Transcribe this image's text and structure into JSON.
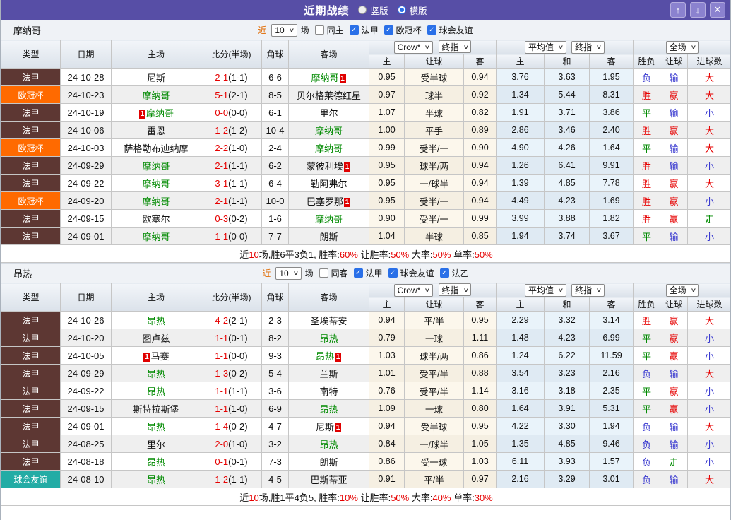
{
  "title_bar": {
    "title": "近期战绩",
    "vertical_label": "竖版",
    "horizontal_label": "横版"
  },
  "glyphs": {
    "up": "↑",
    "down": "↓",
    "close": "✕",
    "check": "✓",
    "chevron_down": "∨"
  },
  "colors": {
    "titlebar_purple": "#574ea6",
    "team_green": "#008a00",
    "score_red": "#e60000",
    "win_red": "#e60000",
    "draw_green": "#008a00",
    "loss_blue": "#3535cf",
    "league": {
      "法甲": "#5d3733",
      "欧冠杯": "#ff6a00",
      "球会友谊": "#23aca5",
      "法乙": "#23aca5"
    }
  },
  "header_labels": {
    "type": "类型",
    "date": "日期",
    "home": "主场",
    "score": "比分(半场)",
    "corner": "角球",
    "away": "客场",
    "bookmaker_select": "Crow*",
    "final_select": "终指",
    "avg_select": "平均值",
    "fulltime_select": "全场",
    "odds_home": "主",
    "odds_handicap": "让球",
    "odds_away": "客",
    "avg_home": "主",
    "avg_draw": "和",
    "avg_away": "客",
    "result_winloss": "胜负",
    "result_handicap": "让球",
    "result_goals": "进球数"
  },
  "tables": [
    {
      "team": "摩纳哥",
      "filter": {
        "near_label": "近",
        "count": "10",
        "unit_label": "场",
        "checkboxes": [
          {
            "label": "同主",
            "checked": false
          },
          {
            "label": "法甲",
            "checked": true
          },
          {
            "label": "欧冠杯",
            "checked": true
          },
          {
            "label": "球会友谊",
            "checked": true
          }
        ]
      },
      "rows": [
        {
          "league": "法甲",
          "date": "24-10-28",
          "home": "尼斯",
          "home_green": false,
          "home_badge": null,
          "score": "2-1",
          "half": "(1-1)",
          "corner": "6-6",
          "away": "摩纳哥",
          "away_green": true,
          "away_badge": "1",
          "odds_home": "0.95",
          "odds_handicap": "受半球",
          "odds_away": "0.94",
          "avg_home": "3.76",
          "avg_draw": "3.63",
          "avg_away": "1.95",
          "result_winloss": "负",
          "result_handicap": "输",
          "result_goals": "大"
        },
        {
          "league": "欧冠杯",
          "date": "24-10-23",
          "home": "摩纳哥",
          "home_green": true,
          "home_badge": null,
          "score": "5-1",
          "half": "(2-1)",
          "corner": "8-5",
          "away": "贝尔格莱德红星",
          "away_green": false,
          "away_badge": null,
          "odds_home": "0.97",
          "odds_handicap": "球半",
          "odds_away": "0.92",
          "avg_home": "1.34",
          "avg_draw": "5.44",
          "avg_away": "8.31",
          "result_winloss": "胜",
          "result_handicap": "赢",
          "result_goals": "大"
        },
        {
          "league": "法甲",
          "date": "24-10-19",
          "home": "摩纳哥",
          "home_green": true,
          "home_badge": "1",
          "score": "0-0",
          "half": "(0-0)",
          "corner": "6-1",
          "away": "里尔",
          "away_green": false,
          "away_badge": null,
          "odds_home": "1.07",
          "odds_handicap": "半球",
          "odds_away": "0.82",
          "avg_home": "1.91",
          "avg_draw": "3.71",
          "avg_away": "3.86",
          "result_winloss": "平",
          "result_handicap": "输",
          "result_goals": "小"
        },
        {
          "league": "法甲",
          "date": "24-10-06",
          "home": "雷恩",
          "home_green": false,
          "home_badge": null,
          "score": "1-2",
          "half": "(1-2)",
          "corner": "10-4",
          "away": "摩纳哥",
          "away_green": true,
          "away_badge": null,
          "odds_home": "1.00",
          "odds_handicap": "平手",
          "odds_away": "0.89",
          "avg_home": "2.86",
          "avg_draw": "3.46",
          "avg_away": "2.40",
          "result_winloss": "胜",
          "result_handicap": "赢",
          "result_goals": "大"
        },
        {
          "league": "欧冠杯",
          "date": "24-10-03",
          "home": "萨格勒布迪纳摩",
          "home_green": false,
          "home_badge": null,
          "score": "2-2",
          "half": "(1-0)",
          "corner": "2-4",
          "away": "摩纳哥",
          "away_green": true,
          "away_badge": null,
          "odds_home": "0.99",
          "odds_handicap": "受半/一",
          "odds_away": "0.90",
          "avg_home": "4.90",
          "avg_draw": "4.26",
          "avg_away": "1.64",
          "result_winloss": "平",
          "result_handicap": "输",
          "result_goals": "大"
        },
        {
          "league": "法甲",
          "date": "24-09-29",
          "home": "摩纳哥",
          "home_green": true,
          "home_badge": null,
          "score": "2-1",
          "half": "(1-1)",
          "corner": "6-2",
          "away": "蒙彼利埃",
          "away_green": false,
          "away_badge": "1",
          "odds_home": "0.95",
          "odds_handicap": "球半/两",
          "odds_away": "0.94",
          "avg_home": "1.26",
          "avg_draw": "6.41",
          "avg_away": "9.91",
          "result_winloss": "胜",
          "result_handicap": "输",
          "result_goals": "小"
        },
        {
          "league": "法甲",
          "date": "24-09-22",
          "home": "摩纳哥",
          "home_green": true,
          "home_badge": null,
          "score": "3-1",
          "half": "(1-1)",
          "corner": "6-4",
          "away": "勒阿弗尔",
          "away_green": false,
          "away_badge": null,
          "odds_home": "0.95",
          "odds_handicap": "一/球半",
          "odds_away": "0.94",
          "avg_home": "1.39",
          "avg_draw": "4.85",
          "avg_away": "7.78",
          "result_winloss": "胜",
          "result_handicap": "赢",
          "result_goals": "大"
        },
        {
          "league": "欧冠杯",
          "date": "24-09-20",
          "home": "摩纳哥",
          "home_green": true,
          "home_badge": null,
          "score": "2-1",
          "half": "(1-1)",
          "corner": "10-0",
          "away": "巴塞罗那",
          "away_green": false,
          "away_badge": "1",
          "odds_home": "0.95",
          "odds_handicap": "受半/一",
          "odds_away": "0.94",
          "avg_home": "4.49",
          "avg_draw": "4.23",
          "avg_away": "1.69",
          "result_winloss": "胜",
          "result_handicap": "赢",
          "result_goals": "小"
        },
        {
          "league": "法甲",
          "date": "24-09-15",
          "home": "欧塞尔",
          "home_green": false,
          "home_badge": null,
          "score": "0-3",
          "half": "(0-2)",
          "corner": "1-6",
          "away": "摩纳哥",
          "away_green": true,
          "away_badge": null,
          "odds_home": "0.90",
          "odds_handicap": "受半/一",
          "odds_away": "0.99",
          "avg_home": "3.99",
          "avg_draw": "3.88",
          "avg_away": "1.82",
          "result_winloss": "胜",
          "result_handicap": "赢",
          "result_goals": "走"
        },
        {
          "league": "法甲",
          "date": "24-09-01",
          "home": "摩纳哥",
          "home_green": true,
          "home_badge": null,
          "score": "1-1",
          "half": "(0-0)",
          "corner": "7-7",
          "away": "朗斯",
          "away_green": false,
          "away_badge": null,
          "odds_home": "1.04",
          "odds_handicap": "半球",
          "odds_away": "0.85",
          "avg_home": "1.94",
          "avg_draw": "3.74",
          "avg_away": "3.67",
          "result_winloss": "平",
          "result_handicap": "输",
          "result_goals": "小"
        }
      ],
      "summary": [
        {
          "t": "近"
        },
        {
          "t": "10",
          "red": true
        },
        {
          "t": "场,胜6平3负1, 胜率:"
        },
        {
          "t": "60%",
          "red": true
        },
        {
          "t": " 让胜率:"
        },
        {
          "t": "50%",
          "red": true
        },
        {
          "t": " 大率:"
        },
        {
          "t": "50%",
          "red": true
        },
        {
          "t": " 单率:"
        },
        {
          "t": "50%",
          "red": true
        }
      ]
    },
    {
      "team": "昂热",
      "filter": {
        "near_label": "近",
        "count": "10",
        "unit_label": "场",
        "checkboxes": [
          {
            "label": "同客",
            "checked": false
          },
          {
            "label": "法甲",
            "checked": true
          },
          {
            "label": "球会友谊",
            "checked": true
          },
          {
            "label": "法乙",
            "checked": true
          }
        ]
      },
      "rows": [
        {
          "league": "法甲",
          "date": "24-10-26",
          "home": "昂热",
          "home_green": true,
          "home_badge": null,
          "score": "4-2",
          "half": "(2-1)",
          "corner": "2-3",
          "away": "圣埃蒂安",
          "away_green": false,
          "away_badge": null,
          "odds_home": "0.94",
          "odds_handicap": "平/半",
          "odds_away": "0.95",
          "avg_home": "2.29",
          "avg_draw": "3.32",
          "avg_away": "3.14",
          "result_winloss": "胜",
          "result_handicap": "赢",
          "result_goals": "大"
        },
        {
          "league": "法甲",
          "date": "24-10-20",
          "home": "图卢兹",
          "home_green": false,
          "home_badge": null,
          "score": "1-1",
          "half": "(0-1)",
          "corner": "8-2",
          "away": "昂热",
          "away_green": true,
          "away_badge": null,
          "odds_home": "0.79",
          "odds_handicap": "一球",
          "odds_away": "1.11",
          "avg_home": "1.48",
          "avg_draw": "4.23",
          "avg_away": "6.99",
          "result_winloss": "平",
          "result_handicap": "赢",
          "result_goals": "小"
        },
        {
          "league": "法甲",
          "date": "24-10-05",
          "home": "马赛",
          "home_green": false,
          "home_badge": "1",
          "score": "1-1",
          "half": "(0-0)",
          "corner": "9-3",
          "away": "昂热",
          "away_green": true,
          "away_badge": "1",
          "odds_home": "1.03",
          "odds_handicap": "球半/两",
          "odds_away": "0.86",
          "avg_home": "1.24",
          "avg_draw": "6.22",
          "avg_away": "11.59",
          "result_winloss": "平",
          "result_handicap": "赢",
          "result_goals": "小"
        },
        {
          "league": "法甲",
          "date": "24-09-29",
          "home": "昂热",
          "home_green": true,
          "home_badge": null,
          "score": "1-3",
          "half": "(0-2)",
          "corner": "5-4",
          "away": "兰斯",
          "away_green": false,
          "away_badge": null,
          "odds_home": "1.01",
          "odds_handicap": "受平/半",
          "odds_away": "0.88",
          "avg_home": "3.54",
          "avg_draw": "3.23",
          "avg_away": "2.16",
          "result_winloss": "负",
          "result_handicap": "输",
          "result_goals": "大"
        },
        {
          "league": "法甲",
          "date": "24-09-22",
          "home": "昂热",
          "home_green": true,
          "home_badge": null,
          "score": "1-1",
          "half": "(1-1)",
          "corner": "3-6",
          "away": "南特",
          "away_green": false,
          "away_badge": null,
          "odds_home": "0.76",
          "odds_handicap": "受平/半",
          "odds_away": "1.14",
          "avg_home": "3.16",
          "avg_draw": "3.18",
          "avg_away": "2.35",
          "result_winloss": "平",
          "result_handicap": "赢",
          "result_goals": "小"
        },
        {
          "league": "法甲",
          "date": "24-09-15",
          "home": "斯特拉斯堡",
          "home_green": false,
          "home_badge": null,
          "score": "1-1",
          "half": "(1-0)",
          "corner": "6-9",
          "away": "昂热",
          "away_green": true,
          "away_badge": null,
          "odds_home": "1.09",
          "odds_handicap": "一球",
          "odds_away": "0.80",
          "avg_home": "1.64",
          "avg_draw": "3.91",
          "avg_away": "5.31",
          "result_winloss": "平",
          "result_handicap": "赢",
          "result_goals": "小"
        },
        {
          "league": "法甲",
          "date": "24-09-01",
          "home": "昂热",
          "home_green": true,
          "home_badge": null,
          "score": "1-4",
          "half": "(0-2)",
          "corner": "4-7",
          "away": "尼斯",
          "away_green": false,
          "away_badge": "1",
          "odds_home": "0.94",
          "odds_handicap": "受半球",
          "odds_away": "0.95",
          "avg_home": "4.22",
          "avg_draw": "3.30",
          "avg_away": "1.94",
          "result_winloss": "负",
          "result_handicap": "输",
          "result_goals": "大"
        },
        {
          "league": "法甲",
          "date": "24-08-25",
          "home": "里尔",
          "home_green": false,
          "home_badge": null,
          "score": "2-0",
          "half": "(1-0)",
          "corner": "3-2",
          "away": "昂热",
          "away_green": true,
          "away_badge": null,
          "odds_home": "0.84",
          "odds_handicap": "一/球半",
          "odds_away": "1.05",
          "avg_home": "1.35",
          "avg_draw": "4.85",
          "avg_away": "9.46",
          "result_winloss": "负",
          "result_handicap": "输",
          "result_goals": "小"
        },
        {
          "league": "法甲",
          "date": "24-08-18",
          "home": "昂热",
          "home_green": true,
          "home_badge": null,
          "score": "0-1",
          "half": "(0-1)",
          "corner": "7-3",
          "away": "朗斯",
          "away_green": false,
          "away_badge": null,
          "odds_home": "0.86",
          "odds_handicap": "受一球",
          "odds_away": "1.03",
          "avg_home": "6.11",
          "avg_draw": "3.93",
          "avg_away": "1.57",
          "result_winloss": "负",
          "result_handicap": "走",
          "result_goals": "小"
        },
        {
          "league": "球会友谊",
          "date": "24-08-10",
          "home": "昂热",
          "home_green": true,
          "home_badge": null,
          "score": "1-2",
          "half": "(1-1)",
          "corner": "4-5",
          "away": "巴斯蒂亚",
          "away_green": false,
          "away_badge": null,
          "odds_home": "0.91",
          "odds_handicap": "平/半",
          "odds_away": "0.97",
          "avg_home": "2.16",
          "avg_draw": "3.29",
          "avg_away": "3.01",
          "result_winloss": "负",
          "result_handicap": "输",
          "result_goals": "大"
        }
      ],
      "summary": [
        {
          "t": "近"
        },
        {
          "t": "10",
          "red": true
        },
        {
          "t": "场,胜1平4负5, 胜率:"
        },
        {
          "t": "10%",
          "red": true
        },
        {
          "t": " 让胜率:"
        },
        {
          "t": "50%",
          "red": true
        },
        {
          "t": " 大率:"
        },
        {
          "t": "40%",
          "red": true
        },
        {
          "t": " 单率:"
        },
        {
          "t": "30%",
          "red": true
        }
      ]
    }
  ]
}
